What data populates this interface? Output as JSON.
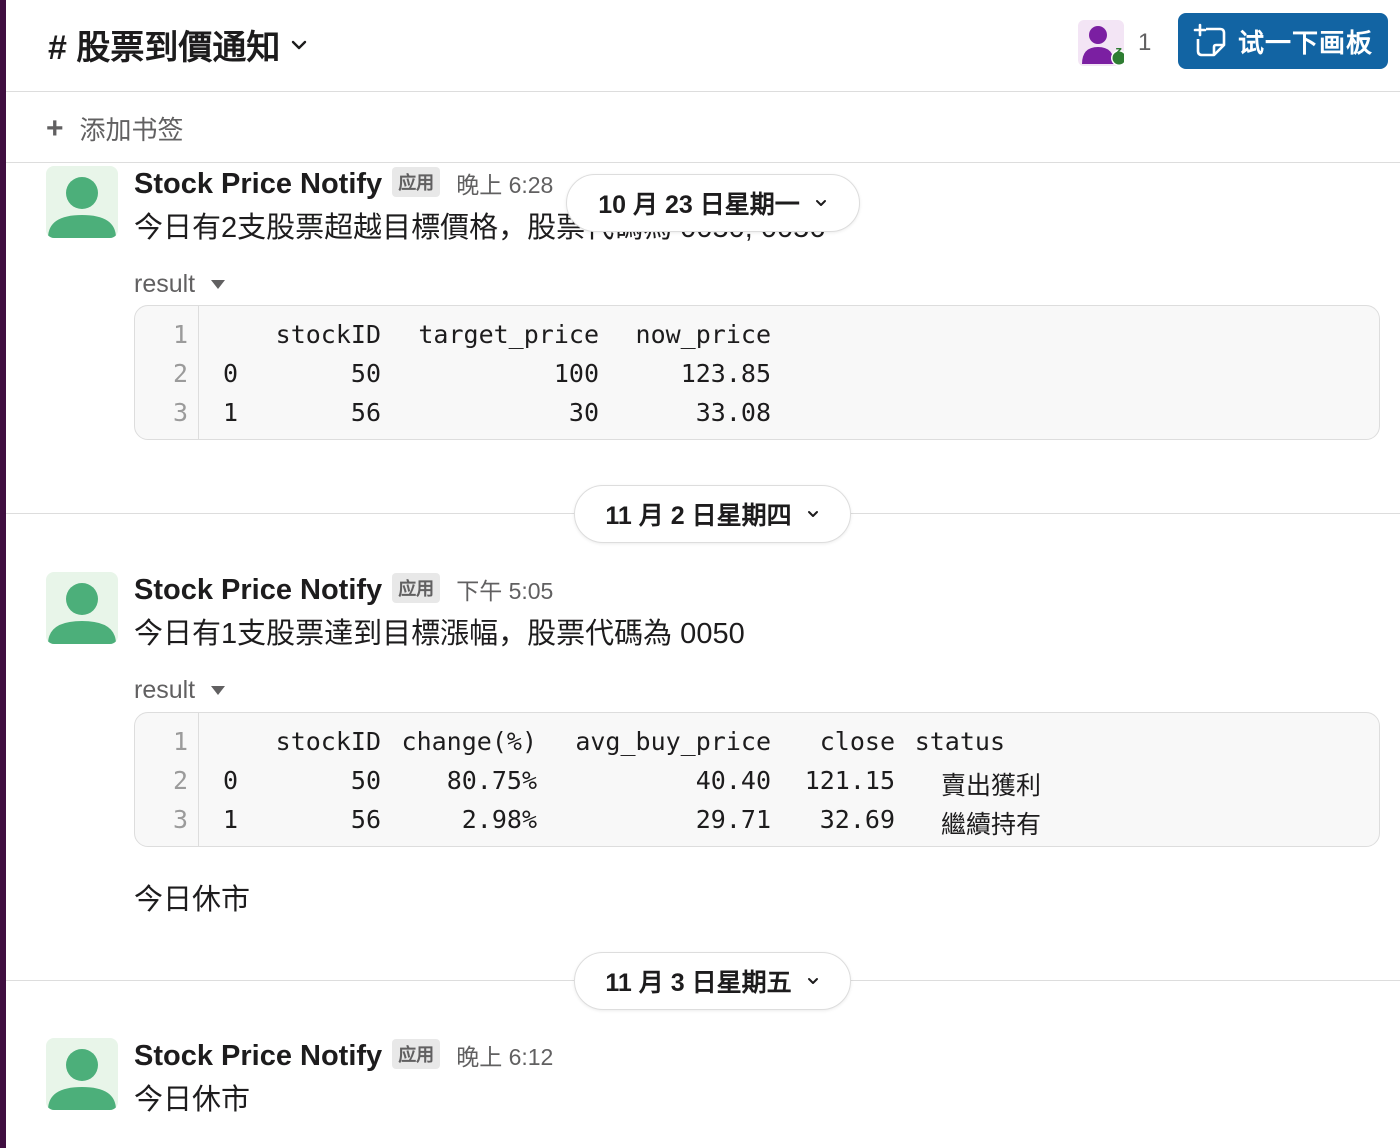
{
  "header": {
    "channel_title": "# 股票到價通知",
    "member_count": "1",
    "canvas_button": "试一下画板"
  },
  "bookmark": {
    "label": "添加书签"
  },
  "colors": {
    "sidebar": "#3f0e40",
    "accent": "#1264a3",
    "avatar_green": "#4caf7a"
  },
  "messages": [
    {
      "date_label": "10 月 23 日星期一",
      "sender": "Stock Price Notify",
      "badge": "应用",
      "time": "晚上 6:28",
      "text": "今日有2支股票超越目標價格，股票代碼為 0050, 0056",
      "attachment_title": "result",
      "table": {
        "line_numbers": [
          "1",
          "2",
          "3"
        ],
        "header": [
          "",
          "stockID",
          "target_price",
          "now_price"
        ],
        "rows": [
          [
            "0",
            "50",
            "100",
            "123.85"
          ],
          [
            "1",
            "56",
            "30",
            "33.08"
          ]
        ]
      }
    },
    {
      "date_label": "11 月 2 日星期四",
      "sender": "Stock Price Notify",
      "badge": "应用",
      "time": "下午 5:05",
      "text": "今日有1支股票達到目標漲幅，股票代碼為 0050",
      "attachment_title": "result",
      "table": {
        "line_numbers": [
          "1",
          "2",
          "3"
        ],
        "header": [
          "",
          "stockID",
          "change(%)",
          "avg_buy_price",
          "close",
          "status"
        ],
        "rows": [
          [
            "0",
            "50",
            "80.75%",
            "40.40",
            "121.15",
            "賣出獲利"
          ],
          [
            "1",
            "56",
            "2.98%",
            "29.71",
            "32.69",
            "繼續持有"
          ]
        ]
      },
      "followup": "今日休市"
    },
    {
      "date_label": "11 月 3 日星期五",
      "sender": "Stock Price Notify",
      "badge": "应用",
      "time": "晚上 6:12",
      "text": "今日休市"
    }
  ]
}
